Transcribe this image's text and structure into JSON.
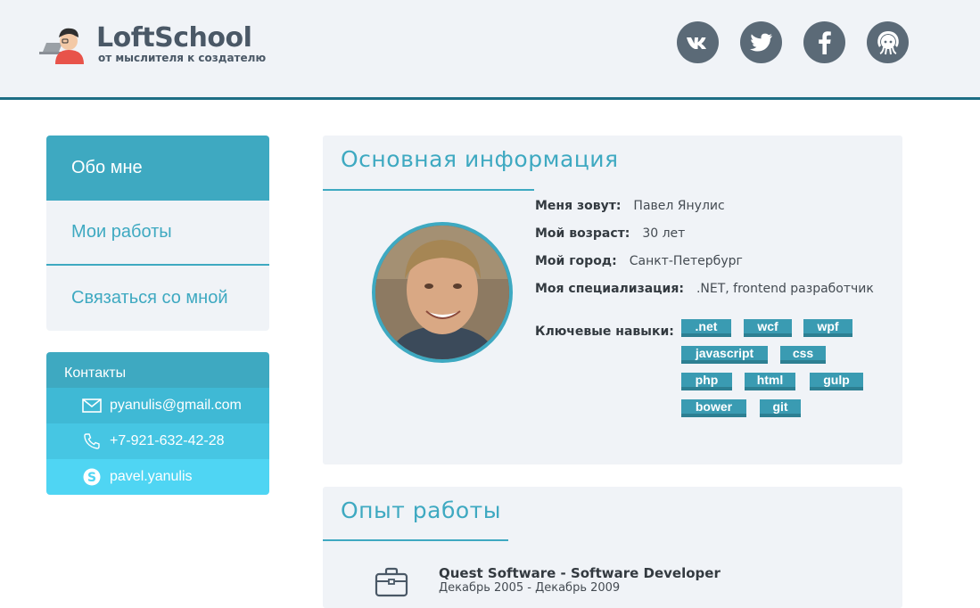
{
  "header": {
    "logo_title": "LoftSchool",
    "logo_subtitle": "от мыслителя к создателю",
    "social": [
      {
        "name": "vk-icon"
      },
      {
        "name": "twitter-icon"
      },
      {
        "name": "facebook-icon"
      },
      {
        "name": "github-icon"
      }
    ]
  },
  "nav": {
    "items": [
      {
        "label": "Обо мне",
        "active": true
      },
      {
        "label": "Мои работы",
        "active": false
      },
      {
        "label": "Связаться со мной",
        "active": false
      }
    ]
  },
  "contacts": {
    "title": "Контакты",
    "email": "pyanulis@gmail.com",
    "phone": "+7-921-632-42-28",
    "skype": "pavel.yanulis"
  },
  "info": {
    "title": "Основная информация",
    "rows": [
      {
        "label": "Меня зовут:",
        "value": "Павел Янулис"
      },
      {
        "label": "Мой возраст:",
        "value": "30 лет"
      },
      {
        "label": "Мой город:",
        "value": "Санкт-Петербург"
      },
      {
        "label": "Моя специализация:",
        "value": ".NET, frontend разработчик"
      }
    ],
    "skills_label": "Ключевые навыки:",
    "skills": [
      ".net",
      "wcf",
      "wpf",
      "javascript",
      "css",
      "php",
      "html",
      "gulp",
      "bower",
      "git"
    ]
  },
  "experience": {
    "title": "Опыт работы",
    "items": [
      {
        "title": "Quest Software - Software Developer",
        "dates": "Декабрь 2005 - Декабрь 2009"
      }
    ]
  },
  "colors": {
    "accent": "#3ea9c1",
    "header_bg": "#f0f3f7",
    "header_border": "#1d6e85",
    "social_bg": "#5b6a77",
    "text_dark": "#333a40"
  }
}
